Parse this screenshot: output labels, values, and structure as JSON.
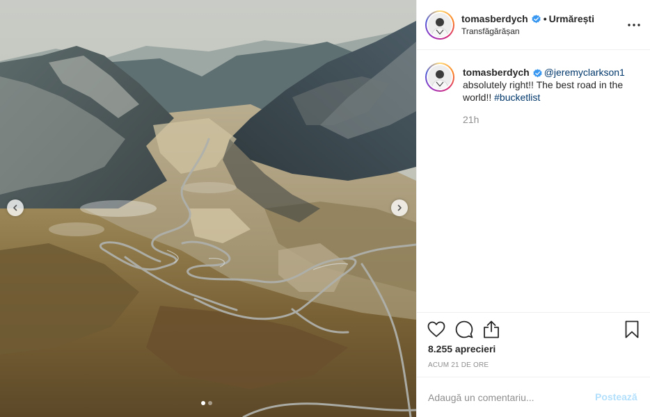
{
  "media": {
    "slide_count": 2,
    "current_slide": 1
  },
  "header": {
    "username": "tomasberdych",
    "separator": "•",
    "follow_label": "Urmărești",
    "location": "Transfăgărășan",
    "more_icon": "more-options-icon"
  },
  "caption": {
    "username": "tomasberdych",
    "mention": "@jeremyclarkson1",
    "text": "absolutely right!! The best road in the world!!",
    "hashtag": "#bucketlist",
    "time": "21h"
  },
  "actions": {
    "icons": [
      "heart-icon",
      "comment-icon",
      "share-icon",
      "bookmark-icon"
    ],
    "likes_label": "8.255 aprecieri",
    "age_label": "ACUM 21 DE ORE"
  },
  "comment_box": {
    "placeholder": "Adaugă un comentariu...",
    "post_label": "Postează"
  },
  "colors": {
    "link": "#00376b",
    "verified": "#3897f0",
    "post_button_disabled": "#b2dffc",
    "muted": "#8e8e8e"
  }
}
